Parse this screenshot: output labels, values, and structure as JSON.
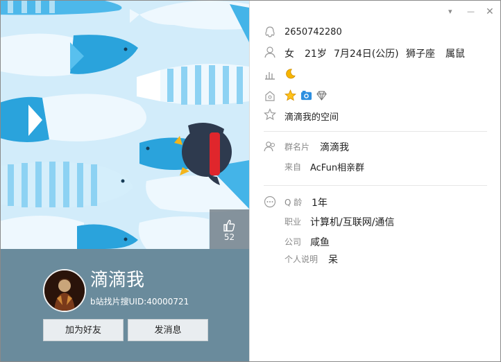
{
  "window": {
    "controls": {
      "dropdown": "▾",
      "minimize": "—",
      "close": "✕"
    }
  },
  "cover": {
    "likes": "52"
  },
  "profile": {
    "nickname": "滴滴我",
    "signature": "b站找片搜UID:40000721",
    "add_friend_label": "加为好友",
    "send_message_label": "发消息"
  },
  "info": {
    "qq_number": "2650742280",
    "gender": "女",
    "age": "21岁",
    "birthday": "7月24日(公历)",
    "zodiac": "狮子座",
    "chinese_zodiac": "属鼠",
    "qzone_label": "滴滴我的空间"
  },
  "group": {
    "card_label": "群名片",
    "card_value": "滴滴我",
    "from_label": "来自",
    "from_value": "AcFun相亲群"
  },
  "details": {
    "qage_label": "Q 龄",
    "qage_value": "1年",
    "job_label": "职业",
    "job_value": "计算机/互联网/通信",
    "company_label": "公司",
    "company_value": "咸鱼",
    "bio_label": "个人说明",
    "bio_value": "呆"
  },
  "colors": {
    "profile_bg": "#6a8b9c",
    "cover_bg": "#d2ecfa",
    "fish_blue": "#2aa3dc",
    "penguin_body": "#2e3a4e",
    "scarf": "#e0262c"
  },
  "icons": [
    "qq-icon",
    "person-icon",
    "level-icon",
    "moon-icon",
    "qzone-icon",
    "star-badge-icon",
    "camera-badge-icon",
    "diamond-badge-icon",
    "favorite-star-icon",
    "group-card-icon",
    "qage-icon",
    "thumb-up-icon"
  ]
}
